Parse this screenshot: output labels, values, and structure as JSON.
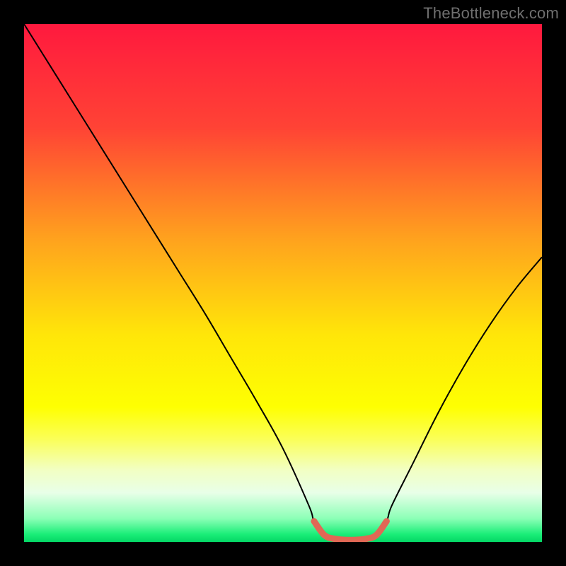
{
  "watermark": "TheBottleneck.com",
  "chart_data": {
    "type": "line",
    "title": "",
    "xlabel": "",
    "ylabel": "",
    "xlim": [
      0,
      100
    ],
    "ylim": [
      0,
      100
    ],
    "grid": false,
    "legend": null,
    "background_gradient_stops": [
      {
        "offset": 0.0,
        "color": "#ff193e"
      },
      {
        "offset": 0.2,
        "color": "#ff4335"
      },
      {
        "offset": 0.42,
        "color": "#ffa41d"
      },
      {
        "offset": 0.6,
        "color": "#ffe609"
      },
      {
        "offset": 0.74,
        "color": "#feff02"
      },
      {
        "offset": 0.8,
        "color": "#fbff56"
      },
      {
        "offset": 0.86,
        "color": "#f2ffc2"
      },
      {
        "offset": 0.905,
        "color": "#e8ffe8"
      },
      {
        "offset": 0.955,
        "color": "#8bffb6"
      },
      {
        "offset": 0.985,
        "color": "#1bee78"
      },
      {
        "offset": 1.0,
        "color": "#04d765"
      }
    ],
    "series": [
      {
        "name": "bottleneck-curve",
        "color": "#000000",
        "width": 2,
        "x": [
          0,
          5,
          10,
          15,
          20,
          25,
          30,
          35,
          40,
          45,
          50,
          55,
          56,
          58,
          60,
          62,
          64,
          66,
          68,
          70,
          71,
          75,
          80,
          85,
          90,
          95,
          100
        ],
        "y": [
          100,
          92,
          84,
          76,
          68,
          60,
          52,
          44,
          35.5,
          27,
          18,
          7,
          4,
          1.3,
          0.6,
          0.4,
          0.4,
          0.6,
          1.3,
          4,
          7,
          15,
          25,
          34,
          42,
          49,
          55
        ]
      },
      {
        "name": "sweet-spot-marker",
        "color": "#e16855",
        "width": 9,
        "linecap": "round",
        "x": [
          56,
          58,
          60,
          62,
          64,
          66,
          68,
          70
        ],
        "y": [
          4.0,
          1.3,
          0.6,
          0.4,
          0.4,
          0.6,
          1.3,
          4.0
        ]
      }
    ]
  }
}
